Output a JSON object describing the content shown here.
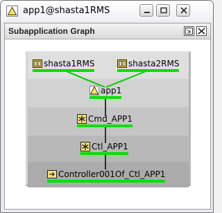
{
  "window": {
    "title": "app1@shasta1RMS"
  },
  "panel": {
    "title": "Subapplication Graph"
  },
  "graph": {
    "nodes": {
      "shasta1": {
        "label": "shasta1RMS",
        "icon": "rms-icon"
      },
      "shasta2": {
        "label": "shasta2RMS",
        "icon": "rms-icon"
      },
      "app1": {
        "label": "app1",
        "icon": "warning-icon"
      },
      "cmd": {
        "label": "Cmd_APP1",
        "icon": "cmd-icon"
      },
      "ctl": {
        "label": "Ctl_APP1",
        "icon": "ctl-icon"
      },
      "controller": {
        "label": "Controller001Of_Ctl_APP1",
        "icon": "controller-icon"
      }
    }
  },
  "colors": {
    "status_online": "#00e000",
    "edge_green": "#00cc00",
    "edge_black": "#000000"
  }
}
